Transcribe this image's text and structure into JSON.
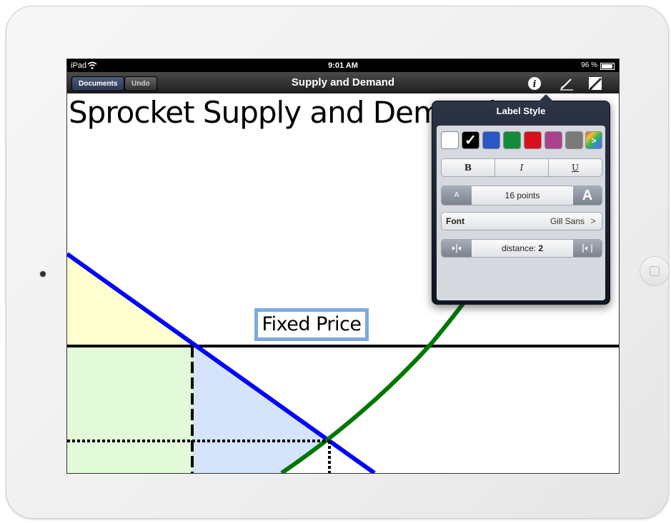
{
  "status_bar": {
    "carrier": "iPad",
    "time": "9:01 AM",
    "battery": "96 %"
  },
  "nav": {
    "documents_label": "Documents",
    "undo_label": "Undo",
    "title": "Supply and Demand"
  },
  "canvas": {
    "title": "Sprocket Supply and Demand",
    "fixed_price_label": "Fixed Price"
  },
  "popover": {
    "title": "Label Style",
    "colors": [
      "#ffffff",
      "#000000",
      "#2857c6",
      "#158a3a",
      "#d9101b",
      "#a8418e",
      "#7a7a7a"
    ],
    "selected_color_index": 1,
    "checkmark": "✓",
    "more_colors_glyph": ">",
    "style_buttons": [
      "B",
      "I",
      "U"
    ],
    "size": {
      "decrease_glyph": "A",
      "value": "16 points",
      "increase_glyph": "A"
    },
    "font": {
      "label": "Font",
      "value": "Gill Sans"
    },
    "distance": {
      "value": "distance: 2"
    }
  },
  "colors": {
    "demand_line": "#0000ff",
    "supply_curve": "#007700",
    "consumer_surplus": "#ffffd0",
    "producer_surplus": "#e2fad8",
    "deadweight_loss": "#d5e4fa",
    "label_border": "#7ea9e0"
  }
}
